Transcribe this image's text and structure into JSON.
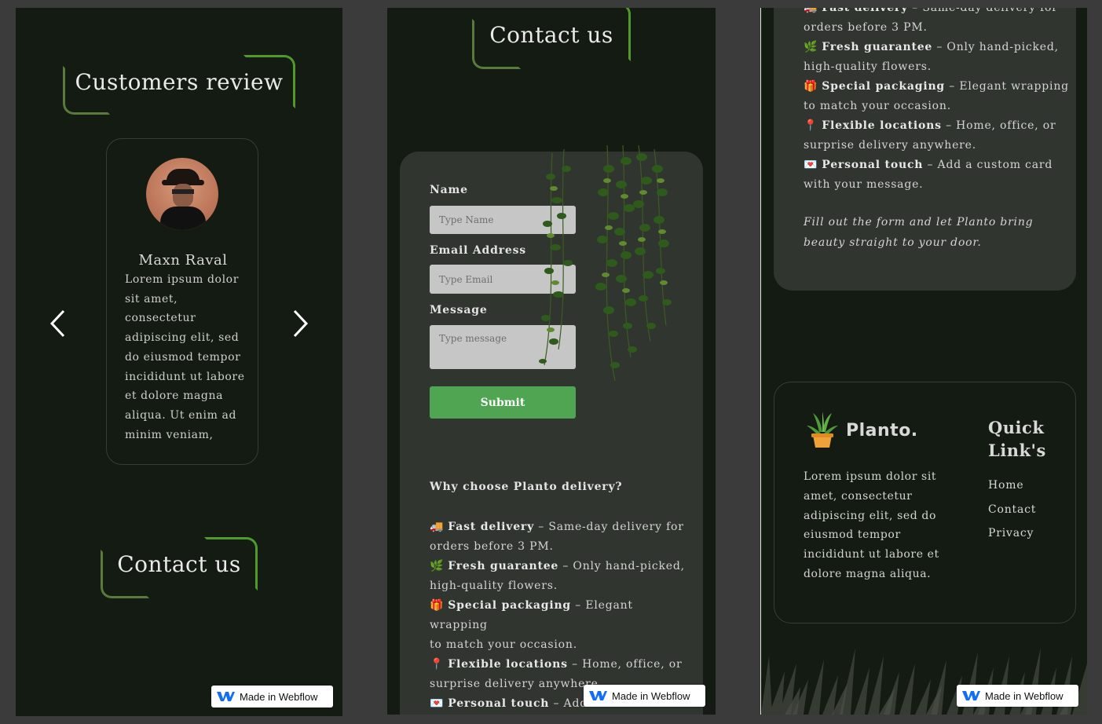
{
  "badge": {
    "label": "Made in Webflow"
  },
  "panel1": {
    "title": "Customers review",
    "review": {
      "name": "Maxn Raval",
      "lines": [
        "Lorem ipsum dolor",
        "sit amet,",
        "consectetur",
        "adipiscing elit, sed",
        "do eiusmod tempor",
        "incididunt ut labore",
        "et dolore magna",
        "aliqua. Ut enim ad",
        "minim veniam,"
      ]
    },
    "contact_title": "Contact us"
  },
  "panel2": {
    "title": "Contact us",
    "form": {
      "name_label": "Name",
      "name_placeholder": "Type Name",
      "email_label": "Email Address",
      "email_placeholder": "Type Email",
      "message_label": "Message",
      "message_placeholder": "Type message",
      "submit_label": "Submit"
    },
    "why_title": "Why choose Planto delivery?",
    "features": [
      {
        "icon": "🚚",
        "title": "Fast delivery",
        "rest1": " – Same-day delivery for",
        "rest2": "orders before 3 PM."
      },
      {
        "icon": "🌿",
        "title": "Fresh guarantee",
        "rest1": " – Only hand-picked,",
        "rest2": "high-quality flowers."
      },
      {
        "icon": "🎁",
        "title": "Special packaging",
        "rest1": " – Elegant wrapping",
        "rest2": "to match your occasion."
      },
      {
        "icon": "📍",
        "title": "Flexible locations",
        "rest1": " – Home, office, or",
        "rest2": "surprise delivery anywhere."
      },
      {
        "icon": "💌",
        "title": "Personal touch",
        "rest1": " – Add a custom card",
        "rest2": "with your message."
      }
    ]
  },
  "panel3": {
    "fill_note_1": "Fill out the form and let Planto bring",
    "fill_note_2": "beauty straight to your door.",
    "brand": "Planto.",
    "footer_lines": [
      "Lorem ipsum dolor sit",
      "amet, consectetur",
      "adipiscing elit, sed do",
      "eiusmod tempor",
      "incididunt ut labore et",
      "dolore magna aliqua."
    ],
    "quick_links_title_1": "Quick",
    "quick_links_title_2": "Link's",
    "links": [
      "Home",
      "Contact",
      "Privacy"
    ]
  },
  "colors": {
    "background": "#141b12",
    "card": "#303530",
    "accent": "#4fa552",
    "bracket": "#4f9a2a"
  }
}
